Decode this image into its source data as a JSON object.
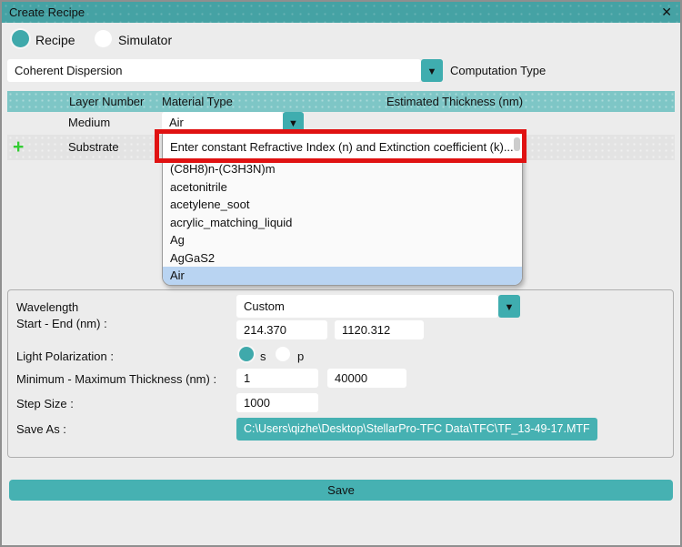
{
  "window": {
    "title": "Create Recipe",
    "close_glyph": "✕"
  },
  "glyphs": {
    "dropdown_arrow": "▼",
    "add": "+"
  },
  "colors": {
    "titlebar_teal": "#45A2A4",
    "header_teal": "#7EC6C6",
    "button_teal": "#46B1B2",
    "arrow_button_teal": "#3FADAF",
    "radio_teal": "#3FA9AB",
    "selected_item_blue": "#B9D4F2",
    "annotation_red": "#E01212",
    "add_green": "#33CC33",
    "background_gray": "#ECECEC"
  },
  "mode": {
    "options": [
      {
        "label": "Recipe",
        "selected": true
      },
      {
        "label": "Simulator",
        "selected": false
      }
    ]
  },
  "computation_type": {
    "selected": "Coherent Dispersion",
    "label": "Computation Type"
  },
  "layer_table": {
    "headers": [
      "Layer Number",
      "Material Type",
      "Estimated Thickness (nm)"
    ],
    "medium_row": {
      "layer": "Medium",
      "material": "Air"
    },
    "substrate_row": {
      "layer": "Substrate"
    }
  },
  "material_dropdown": {
    "custom_entry": "Enter constant Refractive Index (n) and Extinction coefficient (k)...",
    "items": [
      "(C8H8)n-(C3H3N)m",
      "acetonitrile",
      "acetylene_soot",
      "acrylic_matching_liquid",
      "Ag",
      "AgGaS2",
      "Air"
    ],
    "selected": "Air"
  },
  "settings": {
    "wavelength_label_line1": "Wavelength",
    "wavelength_label_line2": "Start - End (nm) :",
    "wavelength_mode": "Custom",
    "wavelength_start": "214.370",
    "wavelength_end": "1120.312",
    "polarization_label": "Light Polarization :",
    "polarization_options": [
      {
        "label": "s",
        "selected": true
      },
      {
        "label": "p",
        "selected": false
      }
    ],
    "thickness_label": "Minimum - Maximum Thickness (nm) :",
    "thickness_min": "1",
    "thickness_max": "40000",
    "step_size_label": "Step Size :",
    "step_size": "1000",
    "save_as_label": "Save As :",
    "save_as_path": "C:\\Users\\qizhe\\Desktop\\StellarPro-TFC Data\\TFC\\TF_13-49-17.MTF"
  },
  "save_button_label": "Save"
}
